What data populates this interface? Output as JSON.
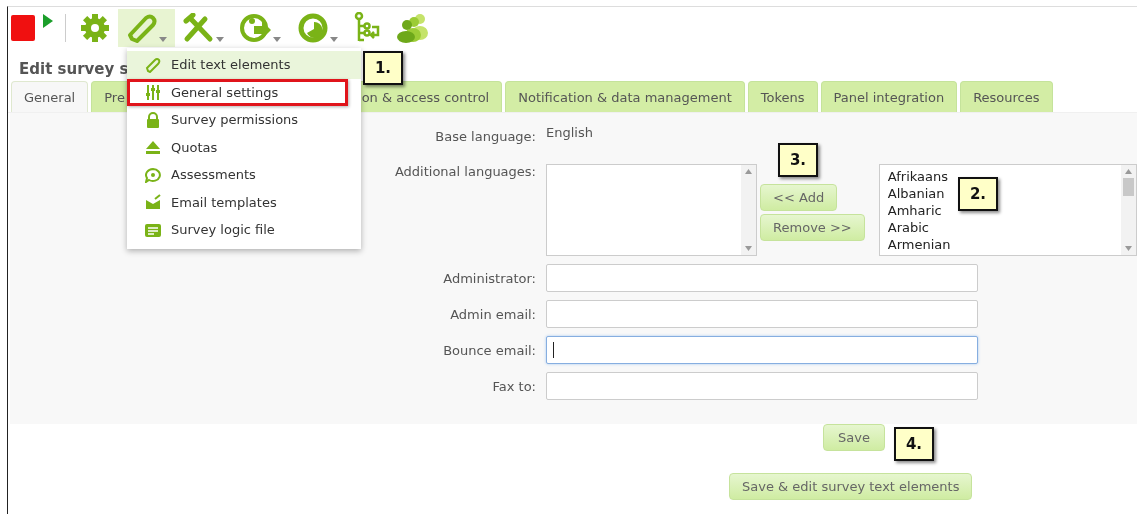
{
  "toolbar": {
    "buttons": [
      {
        "kind": "stop",
        "selected": false
      },
      {
        "kind": "play",
        "selected": false
      },
      {
        "kind": "gear",
        "selected": false
      },
      {
        "kind": "pencil",
        "selected": true,
        "dropdown": true
      },
      {
        "kind": "tools",
        "selected": false,
        "dropdown": true
      },
      {
        "kind": "export",
        "selected": false,
        "dropdown": true
      },
      {
        "kind": "chart",
        "selected": false,
        "dropdown": true
      },
      {
        "kind": "tree",
        "selected": false
      },
      {
        "kind": "people",
        "selected": false
      }
    ]
  },
  "page_title": "Edit survey s",
  "menu": {
    "items": [
      {
        "kind": "pencil",
        "label": "Edit text elements",
        "highlighted": true,
        "outlined": false
      },
      {
        "kind": "sliders",
        "label": "General settings",
        "highlighted": false,
        "outlined": true
      },
      {
        "kind": "lock",
        "label": "Survey permissions",
        "highlighted": false,
        "outlined": false
      },
      {
        "kind": "eject",
        "label": "Quotas",
        "highlighted": false,
        "outlined": false
      },
      {
        "kind": "bubble",
        "label": "Assessments",
        "highlighted": false,
        "outlined": false
      },
      {
        "kind": "mail",
        "label": "Email templates",
        "highlighted": false,
        "outlined": false
      },
      {
        "kind": "qa",
        "label": "Survey logic file",
        "highlighted": false,
        "outlined": false
      }
    ]
  },
  "tabs": [
    {
      "label": "General",
      "selected": true
    },
    {
      "label": "Pre",
      "selected": false
    },
    {
      "label": "on & access control",
      "selected": false
    },
    {
      "label": "Notification & data management",
      "selected": false
    },
    {
      "label": "Tokens",
      "selected": false
    },
    {
      "label": "Panel integration",
      "selected": false
    },
    {
      "label": "Resources",
      "selected": false
    }
  ],
  "form": {
    "base_language_label": "Base language:",
    "base_language": "English",
    "additional_languages_label": "Additional languages:",
    "add_button": "<< Add",
    "remove_button": "Remove >>",
    "available_languages": [
      "Afrikaans",
      "Albanian",
      "Amharic",
      "Arabic",
      "Armenian"
    ],
    "fields": [
      {
        "label": "Administrator:",
        "focused": false
      },
      {
        "label": "Admin email:",
        "focused": false
      },
      {
        "label": "Bounce email:",
        "focused": true
      },
      {
        "label": "Fax to:",
        "focused": false
      }
    ]
  },
  "save_button": "Save",
  "save_edit_button": "Save & edit survey text elements",
  "callouts": [
    {
      "label": "1."
    },
    {
      "label": "2."
    },
    {
      "label": "3."
    },
    {
      "label": "4."
    }
  ]
}
